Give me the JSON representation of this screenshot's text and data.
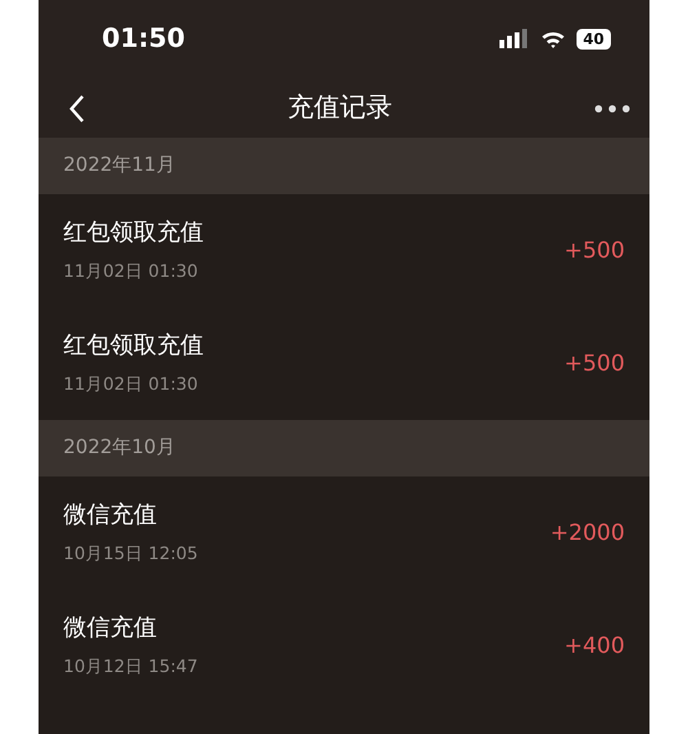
{
  "status_bar": {
    "time": "01:50",
    "battery": "40"
  },
  "nav": {
    "title": "充值记录"
  },
  "sections": [
    {
      "month": "2022年11月",
      "records": [
        {
          "title": "红包领取充值",
          "time": "11月02日 01:30",
          "amount": "+500"
        },
        {
          "title": "红包领取充值",
          "time": "11月02日 01:30",
          "amount": "+500"
        }
      ]
    },
    {
      "month": "2022年10月",
      "records": [
        {
          "title": "微信充值",
          "time": "10月15日 12:05",
          "amount": "+2000"
        },
        {
          "title": "微信充值",
          "time": "10月12日 15:47",
          "amount": "+400"
        }
      ]
    }
  ]
}
